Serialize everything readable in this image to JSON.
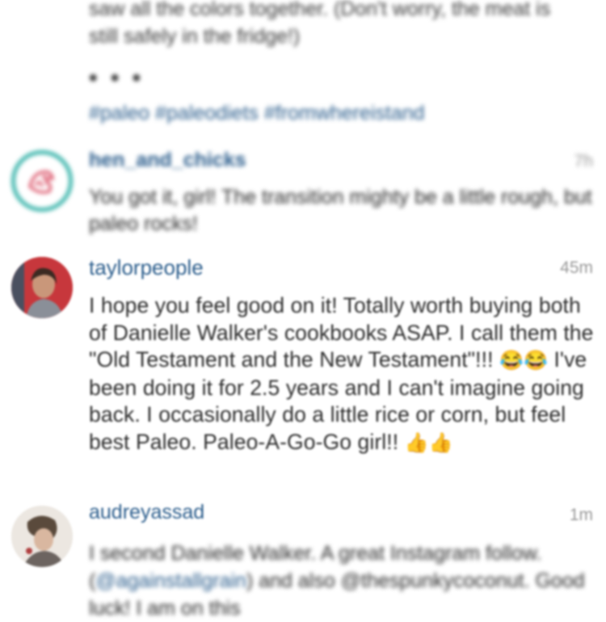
{
  "post": {
    "caption_tail": "saw all the colors together. (Don't worry, the meat is still safely in the fridge!)",
    "ellipsis": "• • •",
    "hashtags": "#paleo #paleodiets #fromwhereistand"
  },
  "comments": [
    {
      "username": "hen_and_chicks",
      "time": "7h",
      "text": "You got it, girl! The transition mighty be a little rough, but paleo rocks!",
      "avatar_icon": "hen-logo-icon"
    },
    {
      "username": "taylorpeople",
      "time": "45m",
      "text_1": "I hope you feel good on it! Totally worth buying both of Danielle Walker's cookbooks ASAP. I call them the \"Old Testament and the New Testament\"!!! ",
      "emoji_1": "😂😂",
      "text_2": " I've been doing it for 2.5 years and I can't imagine going back. I occasionally do a little rice or corn, but feel best Paleo. Paleo-A-Go-Go girl!! ",
      "emoji_2": "👍👍",
      "avatar_icon": "profile-photo-icon"
    },
    {
      "username": "audreyassad",
      "time": "1m",
      "text_1": "I second Danielle Walker. A great Instagram follow. (",
      "mention": "@againstallgrain",
      "text_2": ") and also @thespunkycoconut. Good luck! I am on this",
      "avatar_icon": "profile-photo-icon"
    }
  ],
  "colors": {
    "username": "#2b5d8c",
    "time": "#999999",
    "hen_ring": "#3fb6ad",
    "hen_logo": "#d8455c"
  }
}
